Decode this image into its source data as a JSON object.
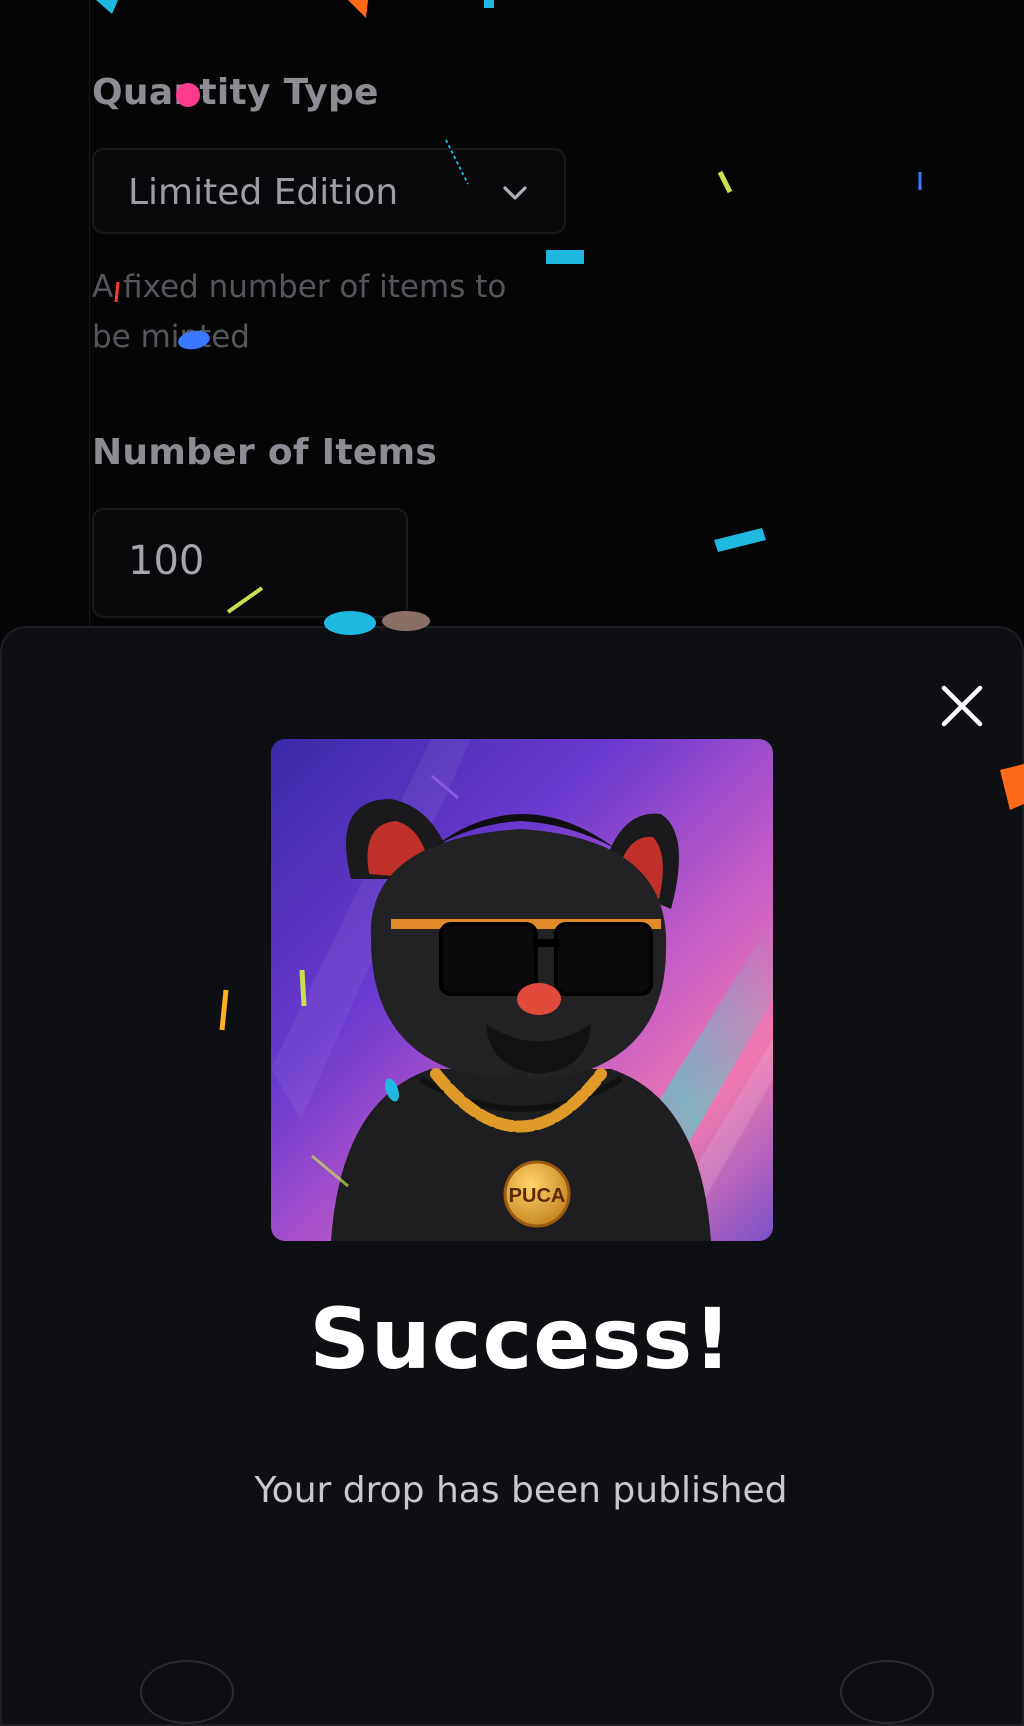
{
  "form": {
    "quantity_type_label": "Quantity Type",
    "quantity_type_value": "Limited Edition",
    "quantity_type_helper": "A fixed number of items to be minted",
    "number_of_items_label": "Number of Items",
    "number_of_items_value": "100"
  },
  "modal": {
    "close_icon": "close-icon",
    "image_badge_text": "PUCA",
    "title": "Success!",
    "subtitle": "Your drop has been published"
  },
  "colors": {
    "background": "#050506",
    "sheet": "#0e0f12",
    "confetti": [
      "#ff3b8d",
      "#1fb8e0",
      "#ff6a1a",
      "#c8e050",
      "#8a6f66",
      "#3a78ff"
    ]
  }
}
